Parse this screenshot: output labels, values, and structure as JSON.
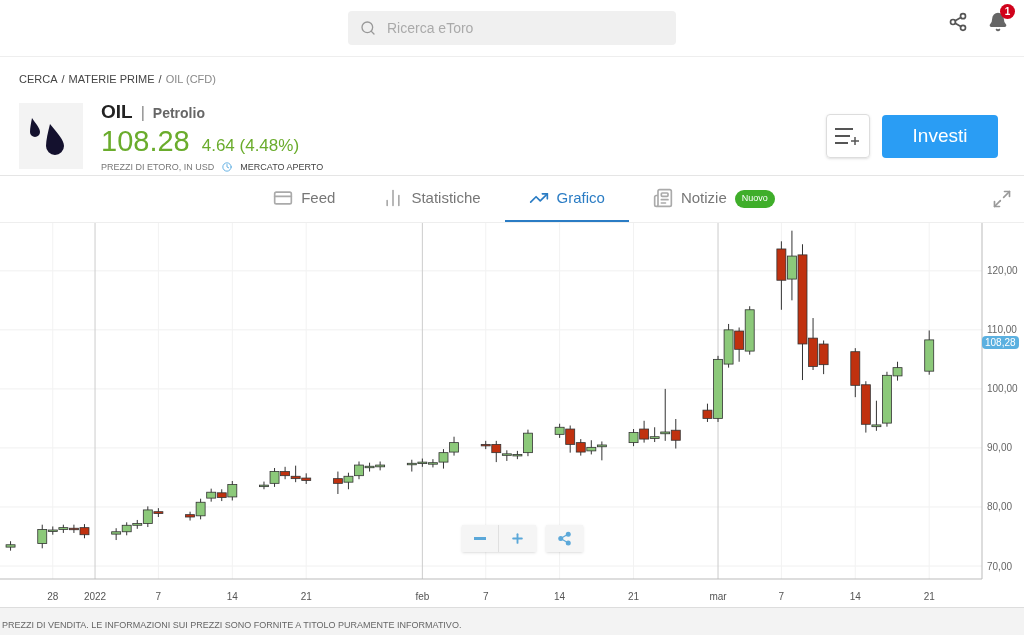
{
  "search": {
    "placeholder": "Ricerca eToro"
  },
  "notifications": {
    "count": "1"
  },
  "breadcrumb": {
    "separator": "/",
    "items": [
      "CERCA",
      "MATERIE PRIME",
      "OIL (CFD)"
    ]
  },
  "instrument": {
    "symbol": "OIL",
    "divider": "|",
    "name": "Petrolio",
    "price": "108.28",
    "change": "4.64 (4.48%)",
    "note": "PREZZI DI ETORO, IN USD",
    "market_status": "MERCATO APERTO"
  },
  "invest_button": "Investi",
  "tabs": [
    {
      "label": "Feed",
      "kind": "feed",
      "selected": false
    },
    {
      "label": "Statistiche",
      "kind": "stats",
      "selected": false
    },
    {
      "label": "Grafico",
      "kind": "chart",
      "selected": true
    },
    {
      "label": "Notizie",
      "kind": "news",
      "selected": false,
      "badge": "Nuovo"
    }
  ],
  "chart": {
    "price_tag": "108,28",
    "chart_data": {
      "type": "candlestick",
      "x": [
        "2021-12-24",
        "2021-12-27",
        "2021-12-28",
        "2021-12-29",
        "2021-12-30",
        "2021-12-31",
        "2022-01-03",
        "2022-01-04",
        "2022-01-05",
        "2022-01-06",
        "2022-01-07",
        "2022-01-10",
        "2022-01-11",
        "2022-01-12",
        "2022-01-13",
        "2022-01-14",
        "2022-01-17",
        "2022-01-18",
        "2022-01-19",
        "2022-01-20",
        "2022-01-21",
        "2022-01-24",
        "2022-01-25",
        "2022-01-26",
        "2022-01-27",
        "2022-01-28",
        "2022-01-31",
        "2022-02-01",
        "2022-02-02",
        "2022-02-03",
        "2022-02-04",
        "2022-02-07",
        "2022-02-08",
        "2022-02-09",
        "2022-02-10",
        "2022-02-11",
        "2022-02-14",
        "2022-02-15",
        "2022-02-16",
        "2022-02-17",
        "2022-02-18",
        "2022-02-21",
        "2022-02-22",
        "2022-02-23",
        "2022-02-24",
        "2022-02-25",
        "2022-02-28",
        "2022-03-01",
        "2022-03-02",
        "2022-03-03",
        "2022-03-04",
        "2022-03-07",
        "2022-03-08",
        "2022-03-09",
        "2022-03-10",
        "2022-03-11",
        "2022-03-14",
        "2022-03-15",
        "2022-03-16",
        "2022-03-17",
        "2022-03-18",
        "2022-03-21"
      ],
      "ohlc": [
        [
          73.2,
          74.2,
          72.6,
          73.6
        ],
        [
          73.8,
          77,
          73,
          76.2
        ],
        [
          75.9,
          76.7,
          75.3,
          76.1
        ],
        [
          76.2,
          77,
          75.6,
          76.5
        ],
        [
          76.4,
          77,
          75.6,
          76.2
        ],
        [
          76.5,
          77.1,
          74.7,
          75.3
        ],
        [
          75.4,
          76.4,
          74.4,
          75.8
        ],
        [
          75.8,
          77.4,
          75.2,
          76.9
        ],
        [
          76.9,
          77.8,
          76.3,
          77.2
        ],
        [
          77.2,
          80.1,
          76.6,
          79.5
        ],
        [
          79.2,
          79.8,
          78.3,
          78.9
        ],
        [
          78.7,
          79.2,
          77.7,
          78.3
        ],
        [
          78.5,
          81.4,
          77.9,
          80.8
        ],
        [
          81.5,
          83.1,
          80.9,
          82.5
        ],
        [
          82.4,
          83,
          81,
          81.6
        ],
        [
          81.7,
          84.4,
          81.1,
          83.8
        ],
        [
          83.5,
          84.3,
          83,
          83.7
        ],
        [
          84,
          86.6,
          83.4,
          86
        ],
        [
          86,
          86.8,
          84.7,
          85.3
        ],
        [
          85.2,
          87,
          84.2,
          84.8
        ],
        [
          84.9,
          85.7,
          83.9,
          84.5
        ],
        [
          84.8,
          86,
          82.2,
          84.0
        ],
        [
          84.2,
          85.8,
          83,
          85.2
        ],
        [
          85.3,
          87.7,
          84.7,
          87.1
        ],
        [
          86.7,
          87.5,
          86,
          86.9
        ],
        [
          86.8,
          87.7,
          86.2,
          87.1
        ],
        [
          87.2,
          88,
          86,
          87.4
        ],
        [
          87.4,
          88.2,
          86.8,
          87.6
        ],
        [
          87.3,
          88.1,
          86.7,
          87.5
        ],
        [
          87.6,
          89.8,
          86.5,
          89.2
        ],
        [
          89.3,
          91.9,
          88.7,
          90.9
        ],
        [
          90.6,
          91.2,
          89.8,
          90.4
        ],
        [
          90.6,
          91.2,
          87.6,
          89.2
        ],
        [
          88.8,
          89.6,
          87.8,
          89
        ],
        [
          88.7,
          89.5,
          88.1,
          88.9
        ],
        [
          89.2,
          93.1,
          88.6,
          92.5
        ],
        [
          92.3,
          94.1,
          91.7,
          93.5
        ],
        [
          93.2,
          93.8,
          89.2,
          90.6
        ],
        [
          90.9,
          91.5,
          88.7,
          89.3
        ],
        [
          89.5,
          91.3,
          88.9,
          90.1
        ],
        [
          90.2,
          91.1,
          87.9,
          90.5
        ],
        [
          90.9,
          93.2,
          90.3,
          92.6
        ],
        [
          93.2,
          94.6,
          90.9,
          91.5
        ],
        [
          91.6,
          93.5,
          91,
          91.9
        ],
        [
          92.4,
          100,
          91.2,
          92.7
        ],
        [
          93,
          94.9,
          89.9,
          91.3
        ],
        [
          96.4,
          97.5,
          94.4,
          95
        ],
        [
          95,
          105.6,
          94.4,
          105
        ],
        [
          104.2,
          111,
          103.6,
          110
        ],
        [
          109.8,
          110.4,
          104.6,
          106.7
        ],
        [
          106.4,
          114,
          105.8,
          113.4
        ],
        [
          123.7,
          125,
          113.4,
          118.4
        ],
        [
          118.6,
          126.8,
          115,
          122.5
        ],
        [
          122.7,
          124.5,
          101.5,
          107.6
        ],
        [
          108.6,
          112,
          103.2,
          103.8
        ],
        [
          107.6,
          108.2,
          102.5,
          104.1
        ],
        [
          106.3,
          106.9,
          98.6,
          100.6
        ],
        [
          100.7,
          101.3,
          92.6,
          94.0
        ],
        [
          93.6,
          98,
          92.9,
          93.9
        ],
        [
          94.2,
          102.9,
          93.6,
          102.3
        ],
        [
          102.2,
          104.6,
          101.4,
          103.6
        ],
        [
          103,
          109.9,
          102.4,
          108.3
        ]
      ],
      "xlim": [
        "2021-12-23",
        "2022-03-26"
      ],
      "ylim": [
        67.8,
        128.1
      ],
      "yticks": [
        {
          "value": 120,
          "label": "120,00"
        },
        {
          "value": 110,
          "label": "110,00"
        },
        {
          "value": 100,
          "label": "100,00"
        },
        {
          "value": 90,
          "label": "90,00"
        },
        {
          "value": 80,
          "label": "80,00"
        },
        {
          "value": 70,
          "label": "70,00"
        }
      ],
      "xticks": [
        {
          "value": "2021-12-28",
          "label": "28"
        },
        {
          "value": "2022-01-01",
          "label": "2022"
        },
        {
          "value": "2022-01-07",
          "label": "7"
        },
        {
          "value": "2022-01-14",
          "label": "14"
        },
        {
          "value": "2022-01-21",
          "label": "21"
        },
        {
          "value": "2022-02-01",
          "label": "feb"
        },
        {
          "value": "2022-02-07",
          "label": "7"
        },
        {
          "value": "2022-02-14",
          "label": "14"
        },
        {
          "value": "2022-02-21",
          "label": "21"
        },
        {
          "value": "2022-03-01",
          "label": "mar"
        },
        {
          "value": "2022-03-07",
          "label": "7"
        },
        {
          "value": "2022-03-14",
          "label": "14"
        },
        {
          "value": "2022-03-21",
          "label": "21"
        }
      ],
      "grid": true
    }
  },
  "footer": "PREZZI DI VENDITA. LE INFORMAZIONI SUI PREZZI SONO FORNITE A TITOLO PURAMENTE INFORMATIVO."
}
